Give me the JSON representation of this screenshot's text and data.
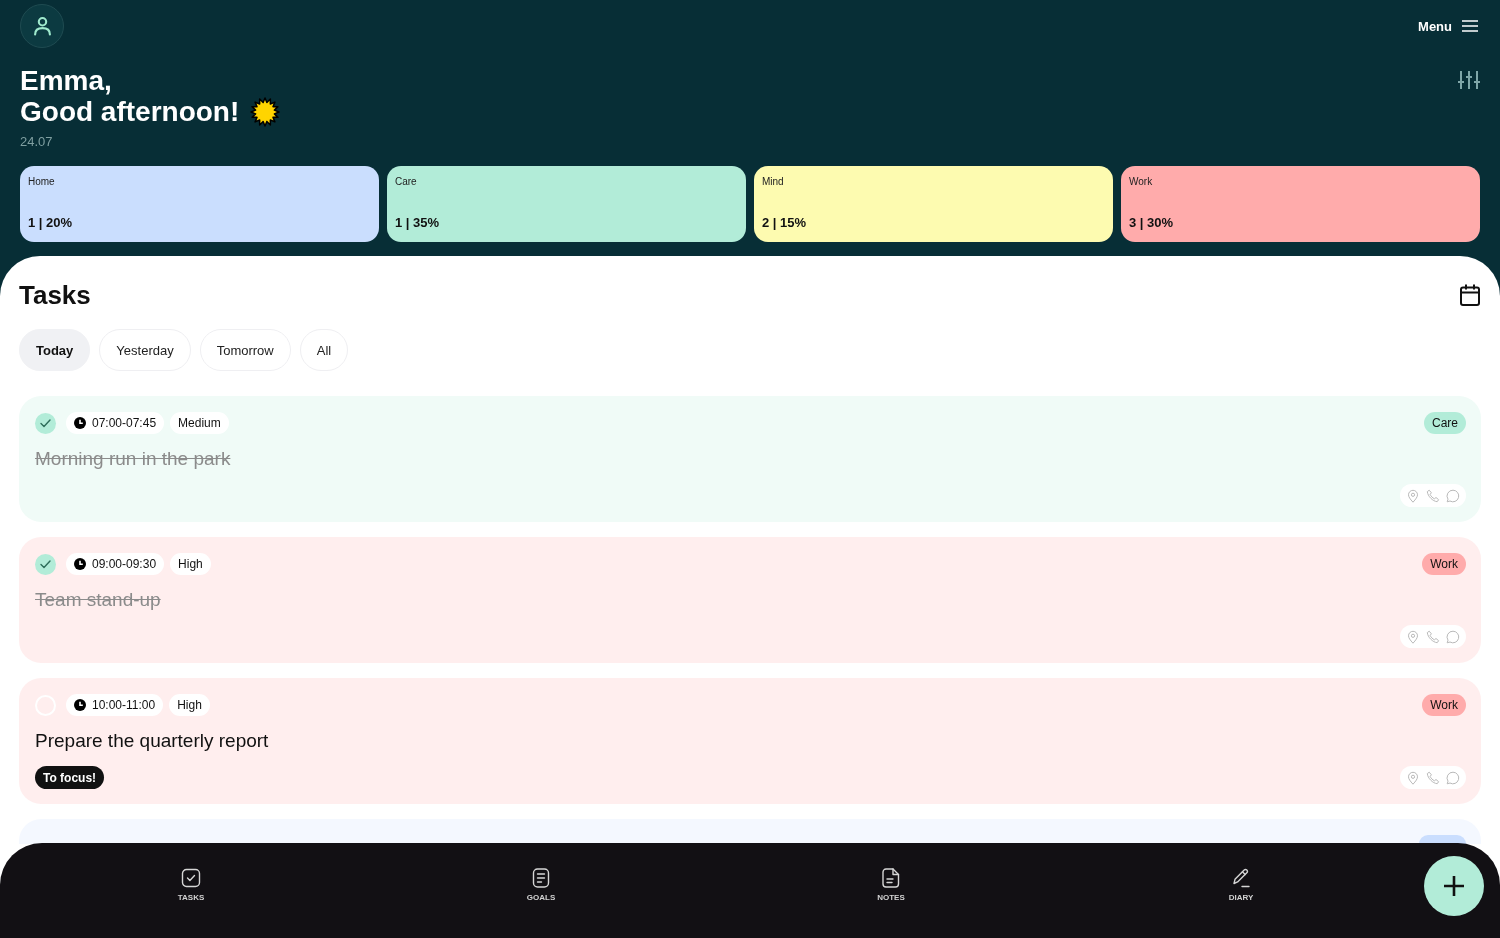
{
  "header": {
    "menu": {
      "label": "Menu"
    },
    "greeting": {
      "name": "Emma,",
      "message": "Good afternoon!"
    },
    "date": "24.07"
  },
  "categories": [
    {
      "label": "Home",
      "stats": "1 | 20%",
      "color": "#cadefe"
    },
    {
      "label": "Care",
      "stats": "1 | 35%",
      "color": "#b2ecd8"
    },
    {
      "label": "Mind",
      "stats": "2 | 15%",
      "color": "#fdfbb0"
    },
    {
      "label": "Work",
      "stats": "3 | 30%",
      "color": "#ffabab"
    }
  ],
  "tasks_section": {
    "title": "Tasks",
    "tabs": [
      {
        "label": "Today",
        "selected": true
      },
      {
        "label": "Yesterday",
        "selected": false
      },
      {
        "label": "Tomorrow",
        "selected": false
      },
      {
        "label": "All",
        "selected": false
      }
    ],
    "tasks": [
      {
        "done": true,
        "time": "07:00-07:45",
        "priority": "Medium",
        "title": "Morning run in the park",
        "category": "Care",
        "color": "#b2ecd8"
      },
      {
        "done": true,
        "time": "09:00-09:30",
        "priority": "High",
        "title": "Team stand-up",
        "category": "Work",
        "color": "#ffabab"
      },
      {
        "done": false,
        "time": "10:00-11:00",
        "priority": "High",
        "title": "Prepare the quarterly report",
        "category": "Work",
        "color": "#ffabab",
        "focus_label": "To focus!"
      },
      {
        "color": "#cadefe"
      }
    ]
  },
  "bottom_nav": {
    "items": [
      {
        "label": "TASKS",
        "kind": "tasks"
      },
      {
        "label": "GOALS",
        "kind": "goals"
      },
      {
        "label": "NOTES",
        "kind": "notes"
      },
      {
        "label": "DIARY",
        "kind": "diary"
      }
    ]
  }
}
